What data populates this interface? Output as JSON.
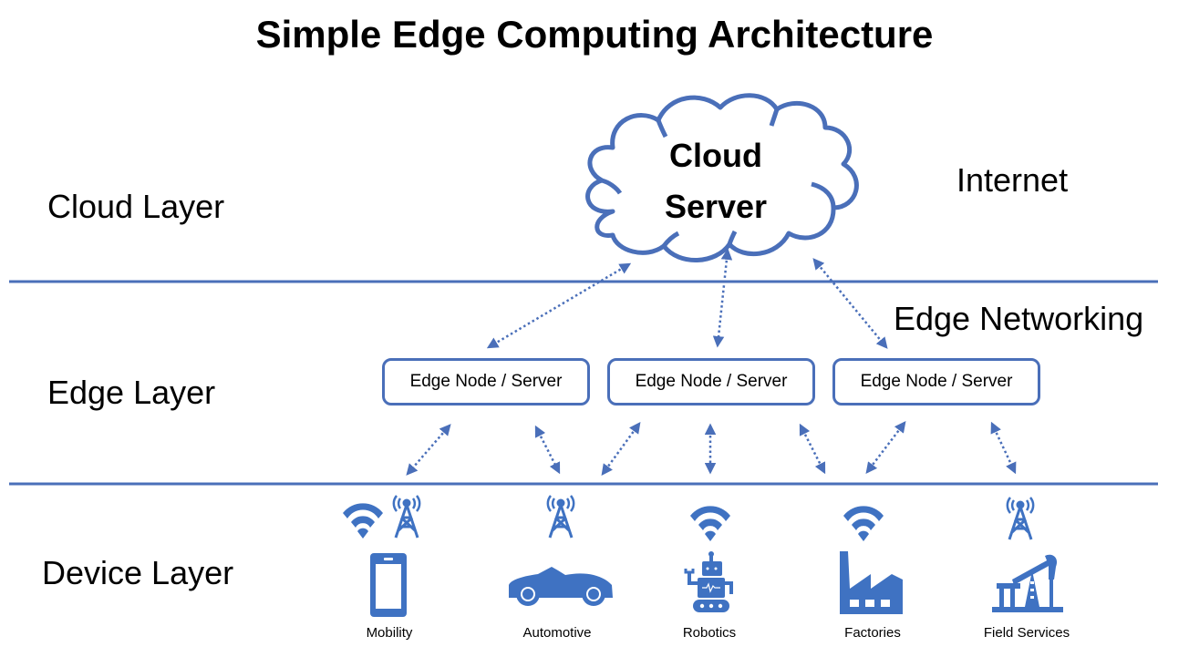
{
  "title": "Simple Edge Computing Architecture",
  "colors": {
    "accent": "#4a6fb9",
    "icon_fill": "#3f72c2",
    "text": "#000000"
  },
  "layers": [
    {
      "label": "Cloud Layer"
    },
    {
      "label": "Edge Layer"
    },
    {
      "label": "Device Layer"
    }
  ],
  "network_labels": {
    "internet": "Internet",
    "edge_networking": "Edge Networking"
  },
  "cloud": {
    "line1": "Cloud",
    "line2": "Server"
  },
  "edge_nodes": [
    {
      "label": "Edge Node / Server"
    },
    {
      "label": "Edge Node / Server"
    },
    {
      "label": "Edge Node / Server"
    }
  ],
  "devices": [
    {
      "label": "Mobility",
      "icon": "smartphone-icon",
      "connectivity": [
        "wifi-icon",
        "cell-tower-icon"
      ]
    },
    {
      "label": "Automotive",
      "icon": "car-icon",
      "connectivity": [
        "cell-tower-icon"
      ]
    },
    {
      "label": "Robotics",
      "icon": "robot-icon",
      "connectivity": [
        "wifi-icon"
      ]
    },
    {
      "label": "Factories",
      "icon": "factory-icon",
      "connectivity": [
        "wifi-icon"
      ]
    },
    {
      "label": "Field Services",
      "icon": "oil-pump-icon",
      "connectivity": [
        "cell-tower-icon"
      ]
    }
  ]
}
